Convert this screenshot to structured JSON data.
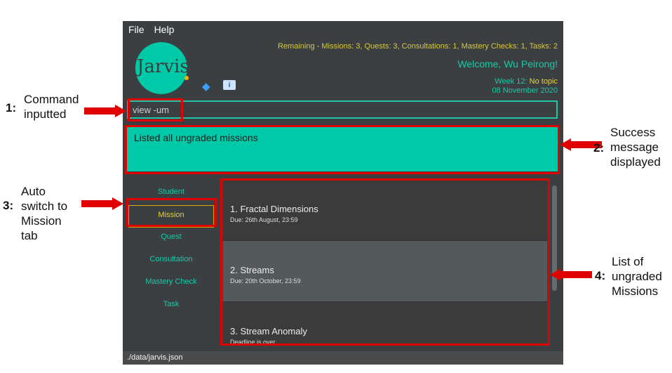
{
  "menu": [
    "File",
    "Help"
  ],
  "logo": "Jarvis",
  "summary": "Remaining - Missions: 3, Quests: 3, Consultations: 1, Mastery Checks: 1, Tasks: 2",
  "welcome": "Welcome, Wu Peirong!",
  "week": {
    "label": "Week 12:",
    "topic": "No topic",
    "date": "08 November 2020"
  },
  "command": {
    "value": "view -um"
  },
  "result": "Listed all ungraded missions",
  "tabs": [
    "Student",
    "Mission",
    "Quest",
    "Consultation",
    "Mastery Check",
    "Task"
  ],
  "missions": [
    {
      "title": "1.  Fractal Dimensions",
      "due": "Due: 26th August, 23:59"
    },
    {
      "title": "2.  Streams",
      "due": "Due: 20th October, 23:59"
    },
    {
      "title": "3.  Stream Anomaly",
      "due": "Deadline is over"
    }
  ],
  "status": "./data/jarvis.json",
  "annotations": {
    "a1": {
      "num": "1:",
      "text": [
        "Command",
        "inputted"
      ]
    },
    "a2": {
      "num": "2:",
      "text": [
        "Success",
        "message",
        "displayed"
      ]
    },
    "a3": {
      "num": "3:",
      "text": [
        "Auto",
        "switch to",
        "Mission",
        "tab"
      ]
    },
    "a4": {
      "num": "4:",
      "text": [
        "List of",
        "ungraded",
        "Missions"
      ]
    }
  },
  "colors": {
    "accent": "#00c9a7",
    "annotation": "#e00000",
    "panel": "#3c3f41"
  }
}
